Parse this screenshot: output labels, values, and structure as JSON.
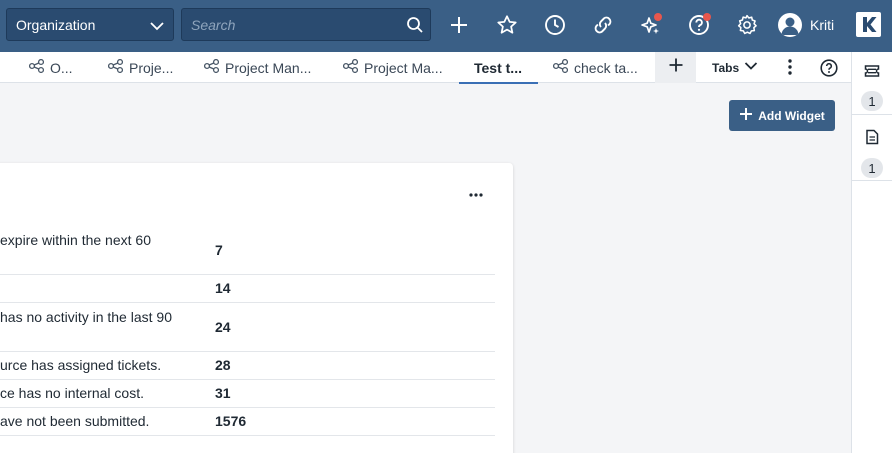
{
  "header": {
    "org_select": "Organization",
    "search_placeholder": "Search",
    "user_name": "Kriti",
    "logo_letter": "K",
    "icons": [
      "plus-icon",
      "star-icon",
      "clock-icon",
      "link-icon",
      "sparkle-icon",
      "help-icon",
      "gear-icon"
    ],
    "accent": "#3a5f86",
    "notification_color": "#e8574d"
  },
  "tabs": [
    {
      "label": "O...",
      "icon": "share-icon"
    },
    {
      "label": "Proje...",
      "icon": "share-icon"
    },
    {
      "label": "Project Man...",
      "icon": "share-icon"
    },
    {
      "label": "Project Ma...",
      "icon": "share-icon"
    },
    {
      "label": "Test t...",
      "icon": "",
      "active": true
    },
    {
      "label": "check ta...",
      "icon": "share-icon"
    }
  ],
  "tab_controls": {
    "tabs_label": "Tabs"
  },
  "rail": [
    {
      "icon": "ticket-icon",
      "count": "1"
    },
    {
      "icon": "document-icon",
      "count": "1"
    }
  ],
  "toolbar": {
    "add_widget_label": "Add Widget"
  },
  "widget": {
    "rows": [
      {
        "label": "expire within the next 60",
        "value": "7"
      },
      {
        "label": "",
        "value": "14"
      },
      {
        "label": "has no activity in the last 90",
        "value": "24"
      },
      {
        "label": "urce has assigned tickets.",
        "value": "28"
      },
      {
        "label": "ce has no internal cost.",
        "value": "31"
      },
      {
        "label": "ave not been submitted.",
        "value": "1576"
      }
    ]
  }
}
